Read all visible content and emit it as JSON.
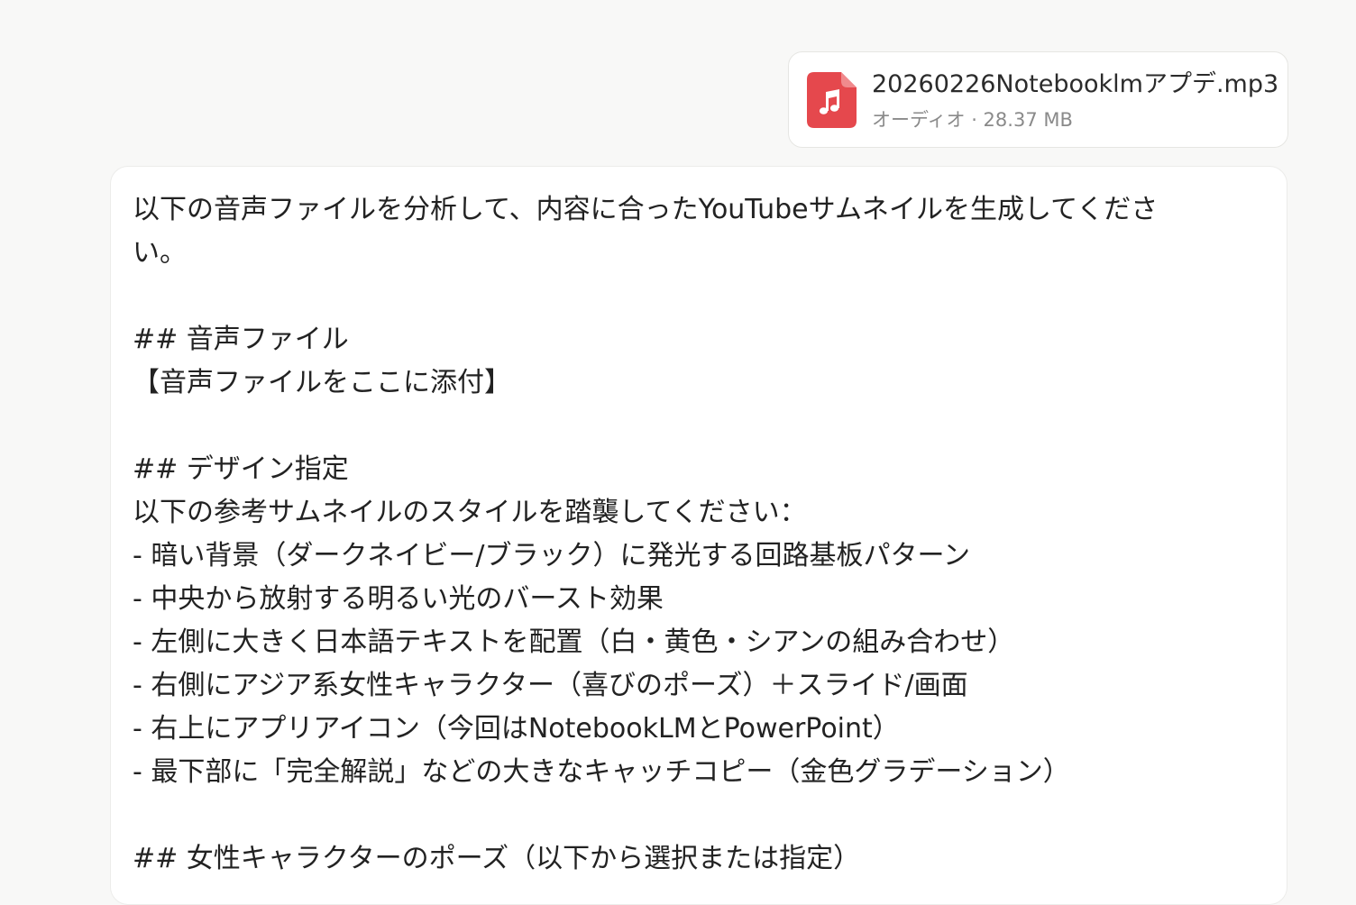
{
  "attachment": {
    "file_name": "20260226Notebooklmアプデ.mp3",
    "meta": "オーディオ · 28.37 MB",
    "icon": "music-file-icon",
    "icon_color": "#e5484d"
  },
  "message": {
    "lines": [
      "以下の音声ファイルを分析して、内容に合ったYouTubeサムネイルを生成してくださ",
      "い。",
      "",
      "## 音声ファイル",
      "【音声ファイルをここに添付】",
      "",
      "## デザイン指定",
      "以下の参考サムネイルのスタイルを踏襲してください：",
      "- 暗い背景（ダークネイビー/ブラック）に発光する回路基板パターン",
      "- 中央から放射する明るい光のバースト効果",
      "- 左側に大きく日本語テキストを配置（白・黄色・シアンの組み合わせ）",
      "- 右側にアジア系女性キャラクター（喜びのポーズ）＋スライド/画面",
      "- 右上にアプリアイコン（今回はNotebookLMとPowerPoint）",
      "- 最下部に「完全解説」などの大きなキャッチコピー（金色グラデーション）",
      "",
      "## 女性キャラクターのポーズ（以下から選択または指定）"
    ]
  }
}
